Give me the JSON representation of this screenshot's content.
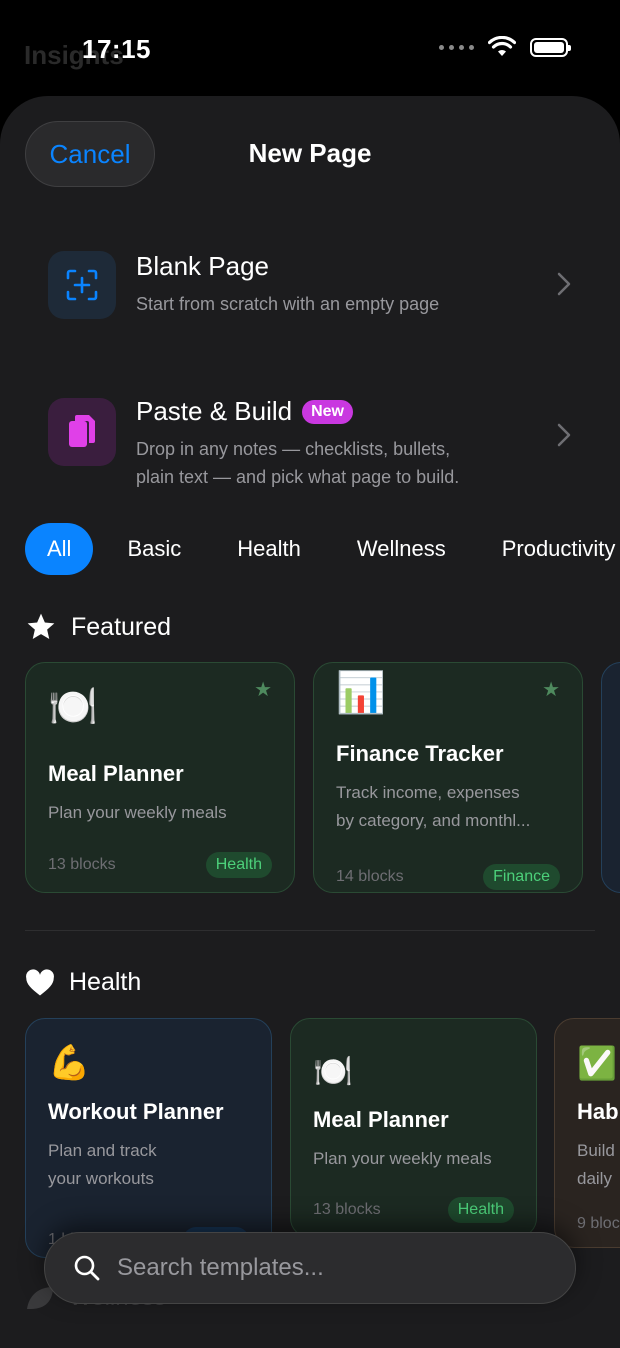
{
  "status": {
    "time": "17:15",
    "background_title": "Insights"
  },
  "sheet": {
    "cancel_label": "Cancel",
    "title": "New Page"
  },
  "options": [
    {
      "title": "Blank Page",
      "subtitle": "Start from scratch with an empty page",
      "icon": "plus-square-icon"
    },
    {
      "title": "Paste & Build",
      "badge": "New",
      "subtitle_line1": "Drop in any notes — checklists, bullets,",
      "subtitle_line2": "plain text — and pick what page to build.",
      "icon": "paste-document-icon"
    }
  ],
  "filters": [
    "All",
    "Basic",
    "Health",
    "Wellness",
    "Productivity"
  ],
  "active_filter": "All",
  "featured": {
    "heading": "Featured",
    "cards": [
      {
        "emoji": "🍽️",
        "title": "Meal Planner",
        "desc": "Plan your weekly meals",
        "blocks": "13 blocks",
        "tag": "Health"
      },
      {
        "emoji": "📊",
        "title": "Finance Tracker",
        "desc_line1": "Track income, expenses",
        "desc_line2": "by category, and monthl...",
        "blocks": "14 blocks",
        "tag": "Finance"
      }
    ]
  },
  "health": {
    "heading": "Health",
    "cards": [
      {
        "emoji": "💪",
        "title": "Workout Planner",
        "desc_line1": "Plan and track",
        "desc_line2": "your workouts",
        "blocks": "1 blocks",
        "tag": "Health"
      },
      {
        "emoji": "🍽️",
        "title": "Meal Planner",
        "desc": "Plan your weekly meals",
        "blocks": "13 blocks",
        "tag": "Health"
      },
      {
        "emoji": "✅",
        "title": "Hab",
        "desc_line1": "Build",
        "desc_line2": "daily",
        "blocks": "9 bloc"
      }
    ]
  },
  "wellness": {
    "heading": "Wellness"
  },
  "search": {
    "placeholder": "Search templates..."
  },
  "colors": {
    "accent": "#0a84ff",
    "badge": "#c938e0",
    "sheet_bg": "#1c1c1e"
  }
}
